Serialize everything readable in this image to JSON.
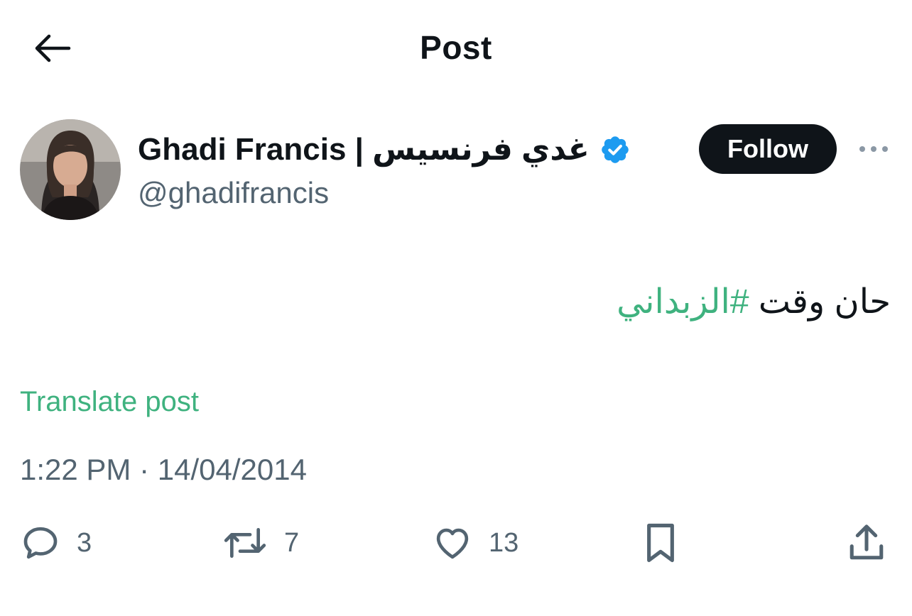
{
  "header": {
    "title": "Post",
    "back_icon": "arrow-left-icon"
  },
  "author": {
    "display_name": "Ghadi Francis | غدي فرنسيس",
    "handle": "@ghadifrancis",
    "verified": true,
    "badge_color": "#1d9bf0",
    "follow_label": "Follow"
  },
  "post": {
    "text": "حان وقت",
    "hashtag": "#الزبداني",
    "translate_label": "Translate post",
    "timestamp": "1:22 PM · 14/04/2014"
  },
  "actions": {
    "replies": "3",
    "reposts": "7",
    "likes": "13"
  },
  "colors": {
    "accent": "#3fb27f",
    "text_primary": "#0f1419",
    "text_secondary": "#536471"
  }
}
